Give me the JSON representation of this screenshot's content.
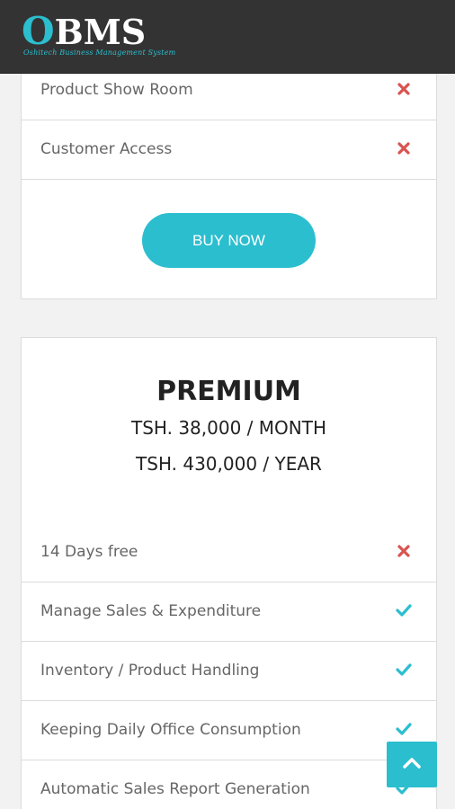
{
  "header": {
    "logo_main": "BMS",
    "logo_letter": "O",
    "logo_tagline": "Oshitech Business Management System"
  },
  "basic_plan": {
    "features": [
      {
        "label": "Product Show Room",
        "included": false
      },
      {
        "label": "Customer Access",
        "included": false
      }
    ],
    "buy_label": "BUY NOW"
  },
  "premium_plan": {
    "title": "PREMIUM",
    "price_month": "TSH. 38,000 / MONTH",
    "price_year": "TSH. 430,000 / YEAR",
    "features": [
      {
        "label": "14 Days free",
        "included": false
      },
      {
        "label": "Manage Sales & Expenditure",
        "included": true
      },
      {
        "label": "Inventory / Product Handling",
        "included": true
      },
      {
        "label": "Keeping Daily Office Consumption",
        "included": true
      },
      {
        "label": "Automatic Sales Report Generation",
        "included": true
      }
    ]
  },
  "colors": {
    "accent": "#2bbecf",
    "cross": "#d9534f",
    "header_bg": "#333333"
  },
  "icons": {
    "included": "check-icon",
    "excluded": "cross-icon",
    "scroll_top": "chevron-up-icon"
  }
}
